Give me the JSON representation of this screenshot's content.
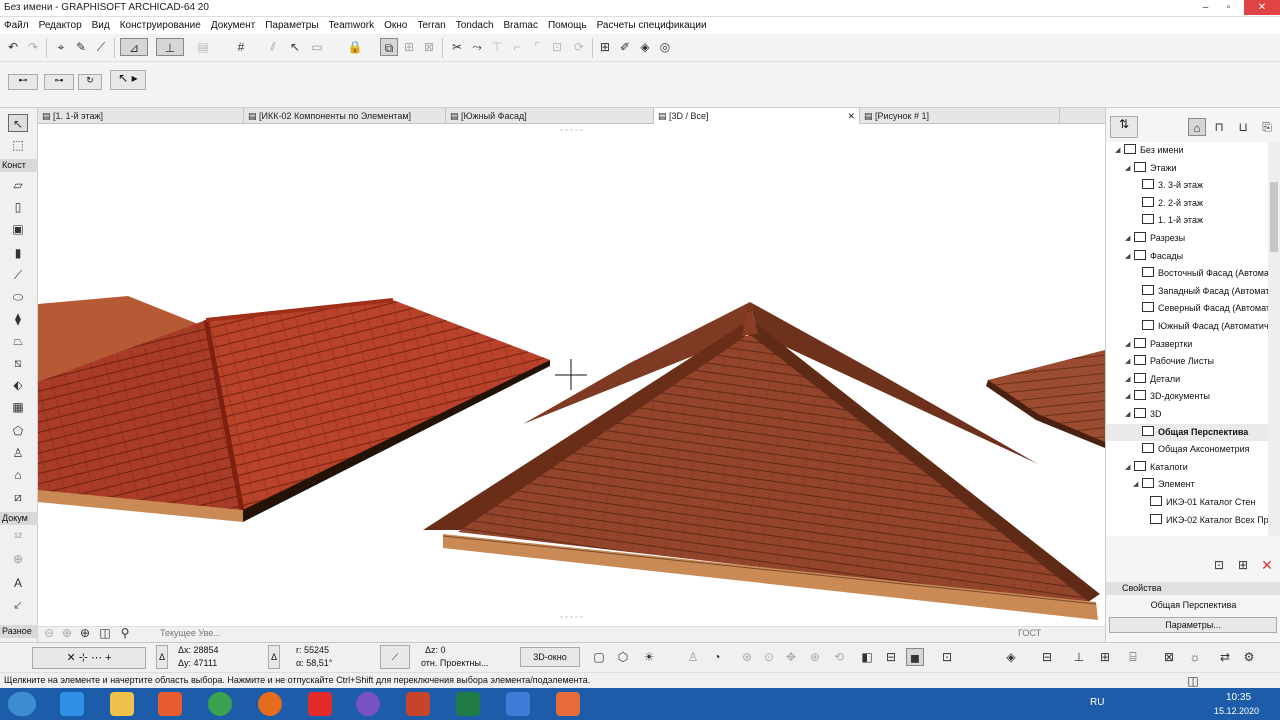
{
  "window": {
    "title": "Без имени - GRAPHISOFT ARCHICAD-64 20"
  },
  "menu": [
    "Файл",
    "Редактор",
    "Вид",
    "Конструирование",
    "Документ",
    "Параметры",
    "Teamwork",
    "Окно",
    "Terran",
    "Tondach",
    "Bramac",
    "Помощь",
    "Расчеты спецификации"
  ],
  "toolbox": {
    "group_design": "Конст",
    "group_document": "Докум",
    "group_misc": "Разное"
  },
  "tabs": [
    "[1. 1-й этаж]",
    "[ИКК-02 Компоненты по Элементам]",
    "[Южный Фасад]",
    "[3D / Все]",
    "[Рисунок # 1]"
  ],
  "view_nav": {
    "view_label": "Текущее Уве..."
  },
  "navigator": {
    "tree": [
      {
        "label": "Без имени",
        "level": 0
      },
      {
        "label": "Этажи",
        "level": 1
      },
      {
        "label": "3. 3-й этаж",
        "level": 2
      },
      {
        "label": "2. 2-й этаж",
        "level": 2
      },
      {
        "label": "1. 1-й этаж",
        "level": 2
      },
      {
        "label": "Разрезы",
        "level": 1
      },
      {
        "label": "Фасады",
        "level": 1
      },
      {
        "label": "Восточный Фасад (Автома",
        "level": 2
      },
      {
        "label": "Западный Фасад (Автомат",
        "level": 2
      },
      {
        "label": "Северный Фасад (Автомат",
        "level": 2
      },
      {
        "label": "Южный Фасад (Автоматич",
        "level": 2
      },
      {
        "label": "Развертки",
        "level": 1
      },
      {
        "label": "Рабочие Листы",
        "level": 1
      },
      {
        "label": "Детали",
        "level": 1
      },
      {
        "label": "3D-документы",
        "level": 1
      },
      {
        "label": "3D",
        "level": 1
      },
      {
        "label": "Общая Перспектива",
        "level": 2,
        "selected": true
      },
      {
        "label": "Общая Аксонометрия",
        "level": 2
      },
      {
        "label": "Каталоги",
        "level": 1
      },
      {
        "label": "Элемент",
        "level": 2
      },
      {
        "label": "ИКЭ-01 Каталог Стен",
        "level": 3
      },
      {
        "label": "ИКЭ-02 Каталог Всех Пр",
        "level": 3
      }
    ],
    "properties_title": "Свойства",
    "properties_value": "Общая Перспектива",
    "params_button": "Параметры...",
    "standard": "ГОСТ"
  },
  "infobox": {
    "dx": "Δx: 28854",
    "dy": "Δy: 47111",
    "r": "r: 55245",
    "angle": "α: 58,51°",
    "dz": "Δz: 0",
    "relative": "отн. Проектны...",
    "window3d": "3D-окно"
  },
  "hint": "Щелкните на элементе и начертите область выбора. Нажмите и не отпускайте Ctrl+Shift для переключения выбора элемента/подэлемента.",
  "taskbar": {
    "lang": "RU",
    "time": "10:35",
    "date": "15.12.2020"
  },
  "colors": {
    "roof_red": "#b03a22",
    "roof_brown": "#8a3d25",
    "taskbar": "#1c5ca8",
    "fascia": "#c98a55"
  }
}
